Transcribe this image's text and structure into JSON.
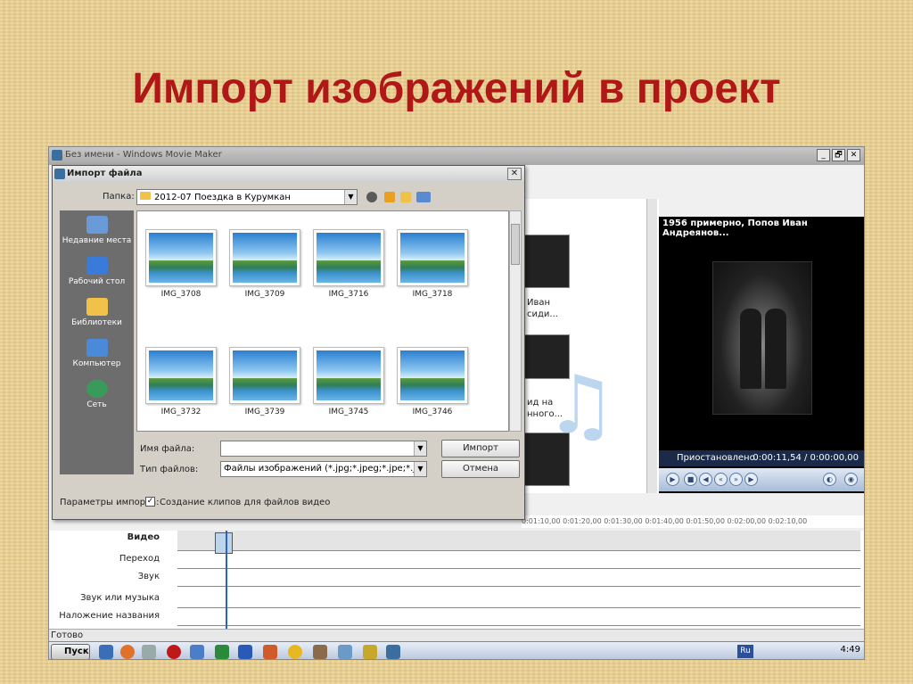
{
  "slide_title": "Импорт изображений в проект",
  "window": {
    "title": "Без имени - Windows Movie Maker",
    "min": "_",
    "max": "🗗",
    "close": "✕"
  },
  "dialog": {
    "title": "Импорт файла",
    "close": "✕",
    "folder_label": "Папка:",
    "folder_value": "2012-07 Поездка в Курумкан",
    "places": [
      "Недавние места",
      "Рабочий стол",
      "Библиотеки",
      "Компьютер",
      "Сеть"
    ],
    "files": [
      "IMG_3708",
      "IMG_3709",
      "IMG_3716",
      "IMG_3718",
      "IMG_3732",
      "IMG_3739",
      "IMG_3745",
      "IMG_3746"
    ],
    "filename_label": "Имя файла:",
    "filename_value": "",
    "filetype_label": "Тип файлов:",
    "filetype_value": "Файлы изображений (*.jpg;*.jpeg;*.jpe;*.jfif;*.gif;*.p",
    "import_button": "Импорт",
    "cancel_button": "Отмена",
    "params_label": "Параметры импорта:",
    "create_clips_label": "Создание клипов для файлов видео",
    "create_clips_checked": "✓"
  },
  "collection": {
    "text1": "Иван",
    "text2": "сиди...",
    "text3": "ид на",
    "text4": "нного..."
  },
  "player": {
    "title": "1956 примерно, Попов Иван Андреянов...",
    "status": "Приостановлено",
    "time": "0:00:11,54 / 0:00:00,00"
  },
  "timeline": {
    "ruler": "0:01:10,00   0:01:20,00   0:01:30,00   0:01:40,00   0:01:50,00   0:02:00,00   0:02:10,00",
    "tracks": [
      "Видео",
      "Переход",
      "Звук",
      "Звук или музыка",
      "Наложение названия"
    ]
  },
  "status": "Готово",
  "taskbar": {
    "start": "Пуск",
    "lang": "Ru",
    "time": "4:49"
  }
}
